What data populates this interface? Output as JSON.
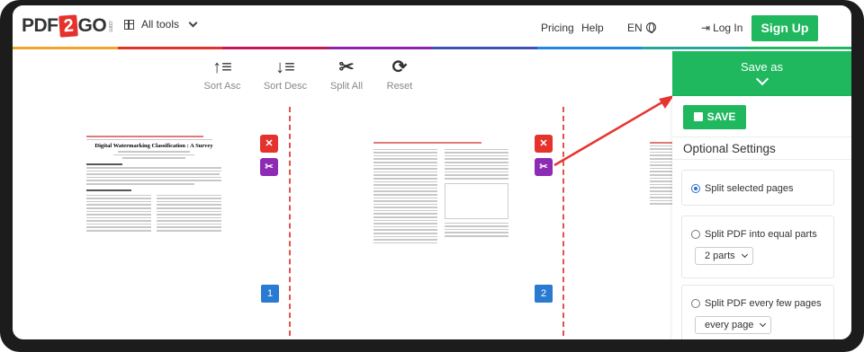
{
  "header": {
    "logo": {
      "left": "PDF",
      "mid": "2",
      "right": "GO",
      "suffix": ".com"
    },
    "all_tools": "All tools",
    "pricing": "Pricing",
    "help": "Help",
    "language": "EN",
    "login": "Log In",
    "signup": "Sign Up",
    "rainbow_colors": [
      "#f2a42a",
      "#e5322d",
      "#c2185b",
      "#8e24aa",
      "#3f51b5",
      "#1e88e5",
      "#26a69a",
      "#1fb85f"
    ]
  },
  "toolbar": {
    "sort_asc": "Sort Asc",
    "sort_desc": "Sort Desc",
    "split_all": "Split All",
    "reset": "Reset"
  },
  "pages": {
    "page1_title": "Digital Watermarking Classification : A Survey",
    "page1_number": "1",
    "page2_number": "2",
    "delete_symbol": "✕",
    "split_symbol": "✂"
  },
  "sidebar": {
    "save_as": "Save as",
    "save_button": "SAVE",
    "optional_settings": "Optional Settings",
    "options": [
      {
        "label": "Split selected pages",
        "selected": true
      },
      {
        "label": "Split PDF into equal parts",
        "selected": false,
        "select_value": "2 parts"
      },
      {
        "label": "Split PDF every few pages",
        "selected": false,
        "select_value": "every page"
      }
    ]
  },
  "colors": {
    "accent_green": "#1fb85f",
    "delete_red": "#e5322d",
    "split_purple": "#8e2bb5",
    "page_number_blue": "#2a7ad1",
    "arrow_red": "#e8342e"
  }
}
